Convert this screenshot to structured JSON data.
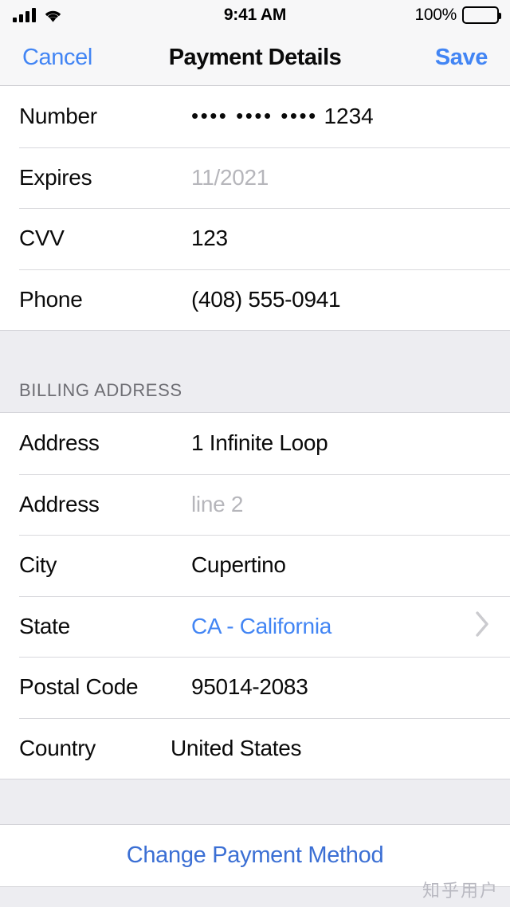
{
  "status_bar": {
    "signal_icon": "cellular-signal-icon",
    "wifi_icon": "wifi-icon",
    "time": "9:41 AM",
    "battery_percent": "100%",
    "battery_icon": "battery-full-icon"
  },
  "nav_bar": {
    "cancel_label": "Cancel",
    "title": "Payment Details",
    "save_label": "Save"
  },
  "card_section": {
    "rows": [
      {
        "label": "Number",
        "value": "•••• •••• •••• 1234",
        "masked_groups": "•••• •••• ••••",
        "visible_digits": "1234",
        "style": "value"
      },
      {
        "label": "Expires",
        "value": "11/2021",
        "style": "placeholder"
      },
      {
        "label": "CVV",
        "value": "123",
        "style": "value"
      },
      {
        "label": "Phone",
        "value": "(408) 555-0941",
        "style": "value"
      }
    ]
  },
  "billing_section": {
    "header": "BILLING ADDRESS",
    "rows": [
      {
        "label": "Address",
        "value": "1 Infinite Loop",
        "style": "value"
      },
      {
        "label": "Address",
        "value": "line 2",
        "style": "placeholder"
      },
      {
        "label": "City",
        "value": "Cupertino",
        "style": "value"
      },
      {
        "label": "State",
        "value": "CA - California",
        "style": "link",
        "accessory": "chevron-right-icon"
      },
      {
        "label": "Postal Code",
        "value": "95014-2083",
        "style": "value"
      },
      {
        "label": "Country",
        "value": "United States",
        "style": "value"
      }
    ]
  },
  "footer": {
    "change_payment_label": "Change Payment Method"
  },
  "watermark": {
    "text": "知乎用户"
  },
  "colors": {
    "accent_blue": "#4285f4",
    "footer_blue": "#3b6fd4",
    "placeholder_gray": "#b6b6bb",
    "section_bg": "#ededf1",
    "row_bg": "#ffffff",
    "separator": "#d9d9dd"
  }
}
